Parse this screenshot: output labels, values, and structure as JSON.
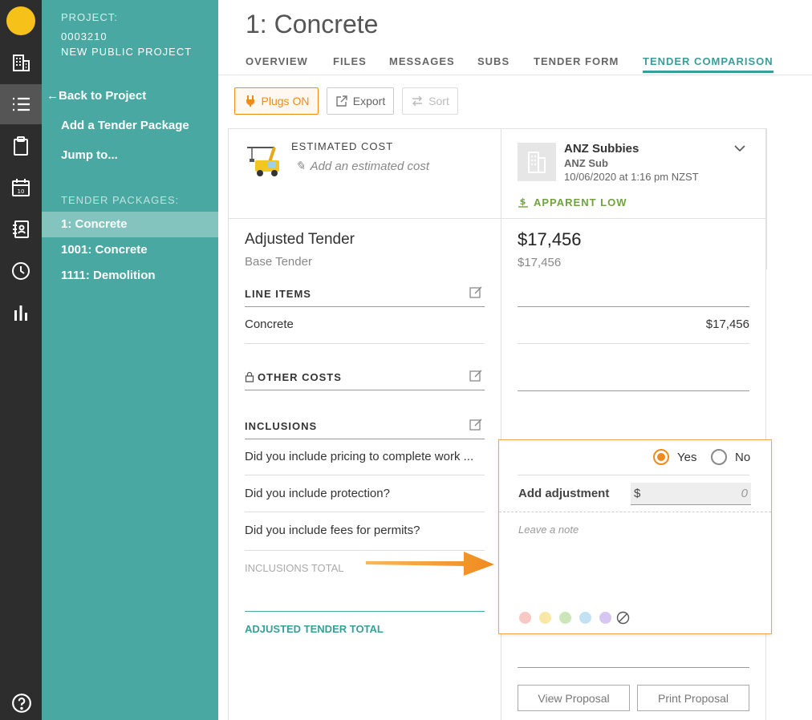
{
  "project": {
    "label": "PROJECT:",
    "number": "0003210",
    "name": "NEW PUBLIC PROJECT"
  },
  "sidebar": {
    "back_link": "Back to Project",
    "add_package": "Add a Tender Package",
    "jump_to": "Jump to...",
    "packages_label": "TENDER PACKAGES:",
    "packages": [
      {
        "label": "1: Concrete"
      },
      {
        "label": "1001: Concrete"
      },
      {
        "label": "1111: Demolition"
      }
    ]
  },
  "rail": {
    "calendar_day": "10"
  },
  "header": {
    "title": "1: Concrete",
    "tabs": [
      {
        "label": "OVERVIEW"
      },
      {
        "label": "FILES"
      },
      {
        "label": "MESSAGES"
      },
      {
        "label": "SUBS"
      },
      {
        "label": "TENDER FORM"
      },
      {
        "label": "TENDER COMPARISON"
      }
    ],
    "active_tab": "TENDER COMPARISON"
  },
  "toolbar": {
    "plugs_label": "Plugs ON",
    "export_label": "Export",
    "sort_label": "Sort"
  },
  "estimate": {
    "label": "ESTIMATED COST",
    "add_placeholder": "Add an estimated cost"
  },
  "bidder": {
    "name": "ANZ Subbies",
    "sub": "ANZ Sub",
    "date": "10/06/2020 at 1:16 pm NZST",
    "badge": "APPARENT LOW",
    "adjusted_amount": "$17,456",
    "base_amount": "$17,456",
    "concrete_amount": "$17,456"
  },
  "comparison": {
    "adjusted_tender": "Adjusted Tender",
    "base_tender": "Base Tender",
    "line_items_label": "LINE ITEMS",
    "line_items": [
      {
        "label": "Concrete"
      }
    ],
    "other_costs_label": "OTHER COSTS",
    "inclusions_label": "INCLUSIONS",
    "inclusions": [
      {
        "label": "Did you include pricing to complete work ..."
      },
      {
        "label": "Did you include protection?"
      },
      {
        "label": "Did you include fees for permits?"
      }
    ],
    "inclusions_total": "INCLUSIONS TOTAL",
    "adjusted_total": "ADJUSTED TENDER TOTAL"
  },
  "popup": {
    "yes_label": "Yes",
    "no_label": "No",
    "selected": "Yes",
    "add_adjustment_label": "Add adjustment",
    "currency": "$",
    "adjustment_value": "0",
    "note_placeholder": "Leave a note",
    "swatches": [
      "#f8c9c4",
      "#f8e7a6",
      "#cbe6b8",
      "#c2e1f3",
      "#d8c6f2"
    ]
  },
  "colors": {
    "teal": "#4aa8a2",
    "accent_orange": "#f08a1d",
    "apparent_low_green": "#6fa33c"
  },
  "actions": {
    "view_proposal": "View Proposal",
    "print_proposal": "Print Proposal"
  }
}
